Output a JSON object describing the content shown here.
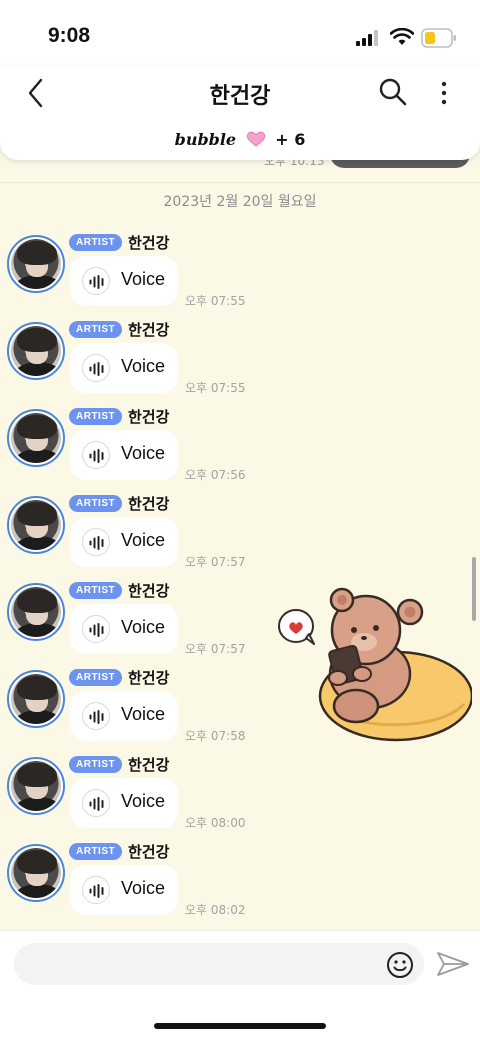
{
  "status_bar": {
    "time": "9:08"
  },
  "header": {
    "title": "한건강",
    "subtitle_logo": "bubble",
    "subtitle_count": "+ 6"
  },
  "peek": {
    "time": "오후 10:13"
  },
  "date_separator": "2023년 2월 20일 월요일",
  "messages": [
    {
      "badge": "ARTIST",
      "sender": "한건강",
      "label": "Voice",
      "time": "오후 07:55"
    },
    {
      "badge": "ARTIST",
      "sender": "한건강",
      "label": "Voice",
      "time": "오후 07:55"
    },
    {
      "badge": "ARTIST",
      "sender": "한건강",
      "label": "Voice",
      "time": "오후 07:56"
    },
    {
      "badge": "ARTIST",
      "sender": "한건강",
      "label": "Voice",
      "time": "오후 07:57"
    },
    {
      "badge": "ARTIST",
      "sender": "한건강",
      "label": "Voice",
      "time": "오후 07:57"
    },
    {
      "badge": "ARTIST",
      "sender": "한건강",
      "label": "Voice",
      "time": "오후 07:58"
    },
    {
      "badge": "ARTIST",
      "sender": "한건강",
      "label": "Voice",
      "time": "오후 08:00"
    },
    {
      "badge": "ARTIST",
      "sender": "한건강",
      "label": "Voice",
      "time": "오후 08:02"
    }
  ],
  "icons": {
    "back": "chevron-left-icon",
    "search": "search-icon",
    "more": "more-vertical-icon",
    "heart": "heart-icon",
    "voice": "waveform-icon",
    "emoji": "emoji-icon",
    "send": "send-icon",
    "sticker": "bear-sticker"
  },
  "colors": {
    "background": "#fbf8e6",
    "badge": "#6c94ee",
    "avatar_ring": "#4a86d9",
    "heart": "#f07cb8"
  },
  "composer": {
    "placeholder": ""
  }
}
